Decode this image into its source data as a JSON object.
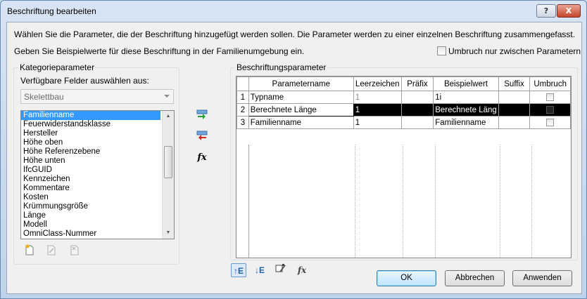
{
  "window": {
    "title": "Beschriftung bearbeiten",
    "help_label": "?",
    "close_label": "X"
  },
  "intro": {
    "line1": "Wählen Sie die Parameter, die der Beschriftung hinzugefügt werden sollen. Die Parameter werden zu einer einzelnen Beschriftung zusammengefasst.",
    "line2": "Geben Sie Beispielwerte für diese Beschriftung in der Familienumgebung ein.",
    "wrap_label": "Umbruch nur zwischen Parametern"
  },
  "category": {
    "group_label": "Kategorieparameter",
    "fields_label": "Verfügbare Felder auswählen aus:",
    "category_value": "Skelettbau",
    "items": [
      "Familienname",
      "Feuerwiderstandsklasse",
      "Hersteller",
      "Höhe oben",
      "Höhe Referenzebene",
      "Höhe unten",
      "IfcGUID",
      "Kennzeichen",
      "Kommentare",
      "Kosten",
      "Krümmungsgröße",
      "Länge",
      "Modell",
      "OmniClass-Nummer"
    ],
    "selected_item": "Familienname"
  },
  "label_params": {
    "group_label": "Beschriftungsparameter",
    "columns": [
      "Parametername",
      "Leerzeichen",
      "Präfix",
      "Beispielwert",
      "Suffix",
      "Umbruch"
    ],
    "rows": [
      {
        "index": "1",
        "name": "Typname",
        "spaces": "1",
        "prefix": "",
        "sample": "1i",
        "suffix": ""
      },
      {
        "index": "2",
        "name": "Berechnete Länge",
        "spaces": "1",
        "prefix": "",
        "sample": "Berechnete Läng",
        "suffix": ""
      },
      {
        "index": "3",
        "name": "Familienname",
        "spaces": "1",
        "prefix": "",
        "sample": "Familienname",
        "suffix": ""
      }
    ]
  },
  "middle_icons": {
    "add_icon": "add-parameter-icon",
    "remove_icon": "remove-parameter-icon",
    "formula_icon": "fx"
  },
  "bottom_tools": {
    "move_up": "↑E",
    "move_down": "↓E",
    "fx_edit": "fx"
  },
  "buttons": {
    "ok": "OK",
    "cancel": "Abbrechen",
    "apply": "Anwenden"
  }
}
